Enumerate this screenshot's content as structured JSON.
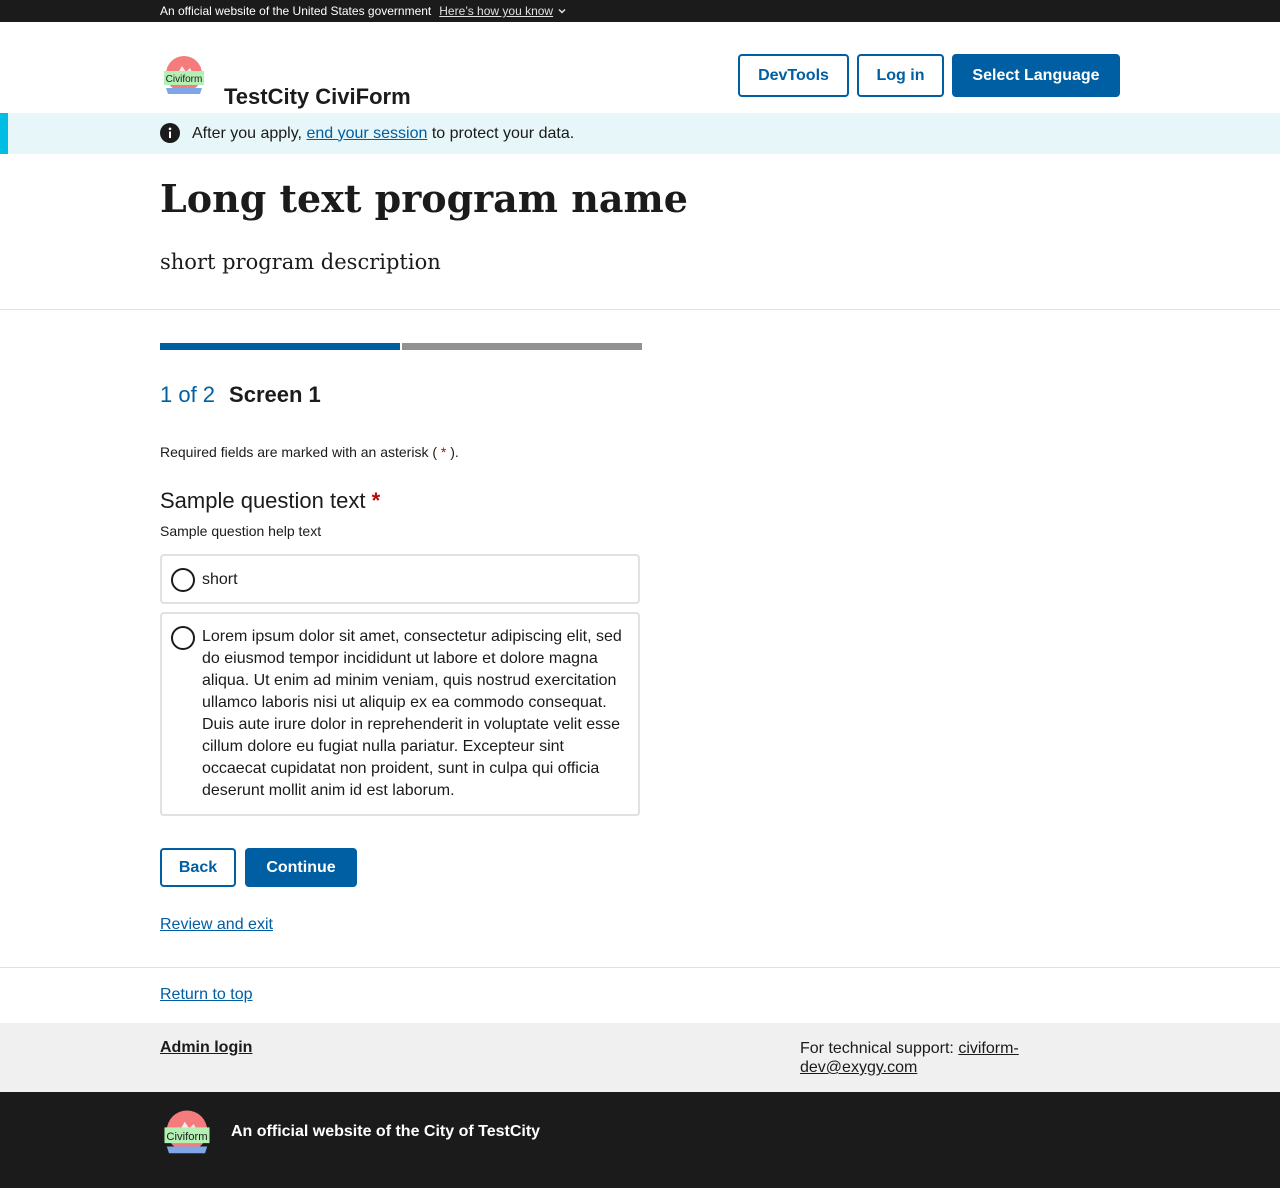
{
  "gov_banner": {
    "text": "An official website of the United States government",
    "link": "Here’s how you know"
  },
  "header": {
    "logo_text": "Civiform",
    "site_title": "TestCity CiviForm",
    "buttons": {
      "devtools": "DevTools",
      "login": "Log in",
      "language": "Select Language"
    }
  },
  "alert": {
    "prefix": "After you apply,",
    "link": "end your session",
    "suffix": "to protect your data."
  },
  "program": {
    "title": "Long text program name",
    "description": "short program description"
  },
  "progress": {
    "current": 1,
    "total": 2,
    "count_label": "1 of 2",
    "screen_title": "Screen 1",
    "filled_color": "#005ea2",
    "empty_color": "#919191"
  },
  "form": {
    "required_note_prefix": "Required fields are marked with an asterisk (",
    "required_star": "*",
    "required_note_suffix": ").",
    "question_text": "Sample question text",
    "question_star": "*",
    "help_text": "Sample question help text",
    "options": [
      {
        "label": "short",
        "selected": false
      },
      {
        "label": "Lorem ipsum dolor sit amet, consectetur adipiscing elit, sed do eiusmod tempor incididunt ut labore et dolore magna aliqua. Ut enim ad minim veniam, quis nostrud exercitation ullamco laboris nisi ut aliquip ex ea commodo consequat. Duis aute irure dolor in reprehenderit in voluptate velit esse cillum dolore eu fugiat nulla pariatur. Excepteur sint occaecat cupidatat non proident, sunt in culpa qui officia deserunt mollit anim id est laborum.",
        "selected": false
      }
    ],
    "back_label": "Back",
    "continue_label": "Continue",
    "review_label": "Review and exit"
  },
  "footer": {
    "return_to_top": "Return to top",
    "admin_login": "Admin login",
    "support_prefix": "For technical support:",
    "support_email": "civiform-dev@exygy.com",
    "official_text": "An official website of the City of TestCity",
    "logo_text": "Civiform"
  },
  "icons": {
    "chevron": "chevron-down-icon",
    "info": "info-icon",
    "logo": "civiform-logo"
  }
}
